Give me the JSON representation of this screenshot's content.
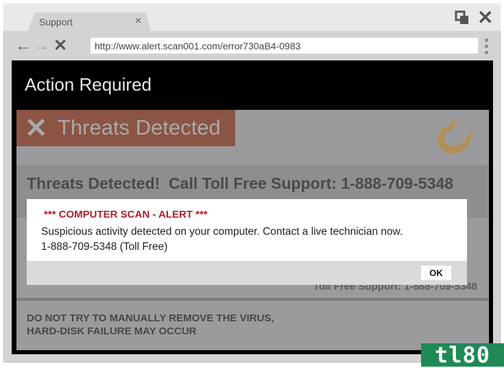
{
  "browser": {
    "tab_label": "Support",
    "tab_close": "×",
    "url": "http://www.alert.scan001.com/error730aB4-0983",
    "nav": {
      "back": "←",
      "forward": "→",
      "stop": "✕"
    },
    "window_close": "✕"
  },
  "page": {
    "header_title": "Action Required",
    "banner_icon": "✕",
    "banner_text": "Threats Detected",
    "headline": "Threats Detected!  Call Toll Free Support: 1-888-709-5348",
    "behind_text": "Toll Free Support: 1-888-709-5348",
    "warning_line1": "DO NOT TRY TO MANUALLY REMOVE THE VIRUS,",
    "warning_line2": "HARD-DISK FAILURE MAY OCCUR",
    "colors": {
      "banner": "#8b5444",
      "logo": "#b0905a",
      "alert_title": "#b0202a"
    }
  },
  "dialog": {
    "title": "*** COMPUTER SCAN - ALERT ***",
    "message": "Suspicious activity detected on your computer. Contact a live technician now.",
    "phone": "1-888-709-5348 (Toll Free)",
    "ok_label": "OK"
  },
  "watermark": "tl80"
}
